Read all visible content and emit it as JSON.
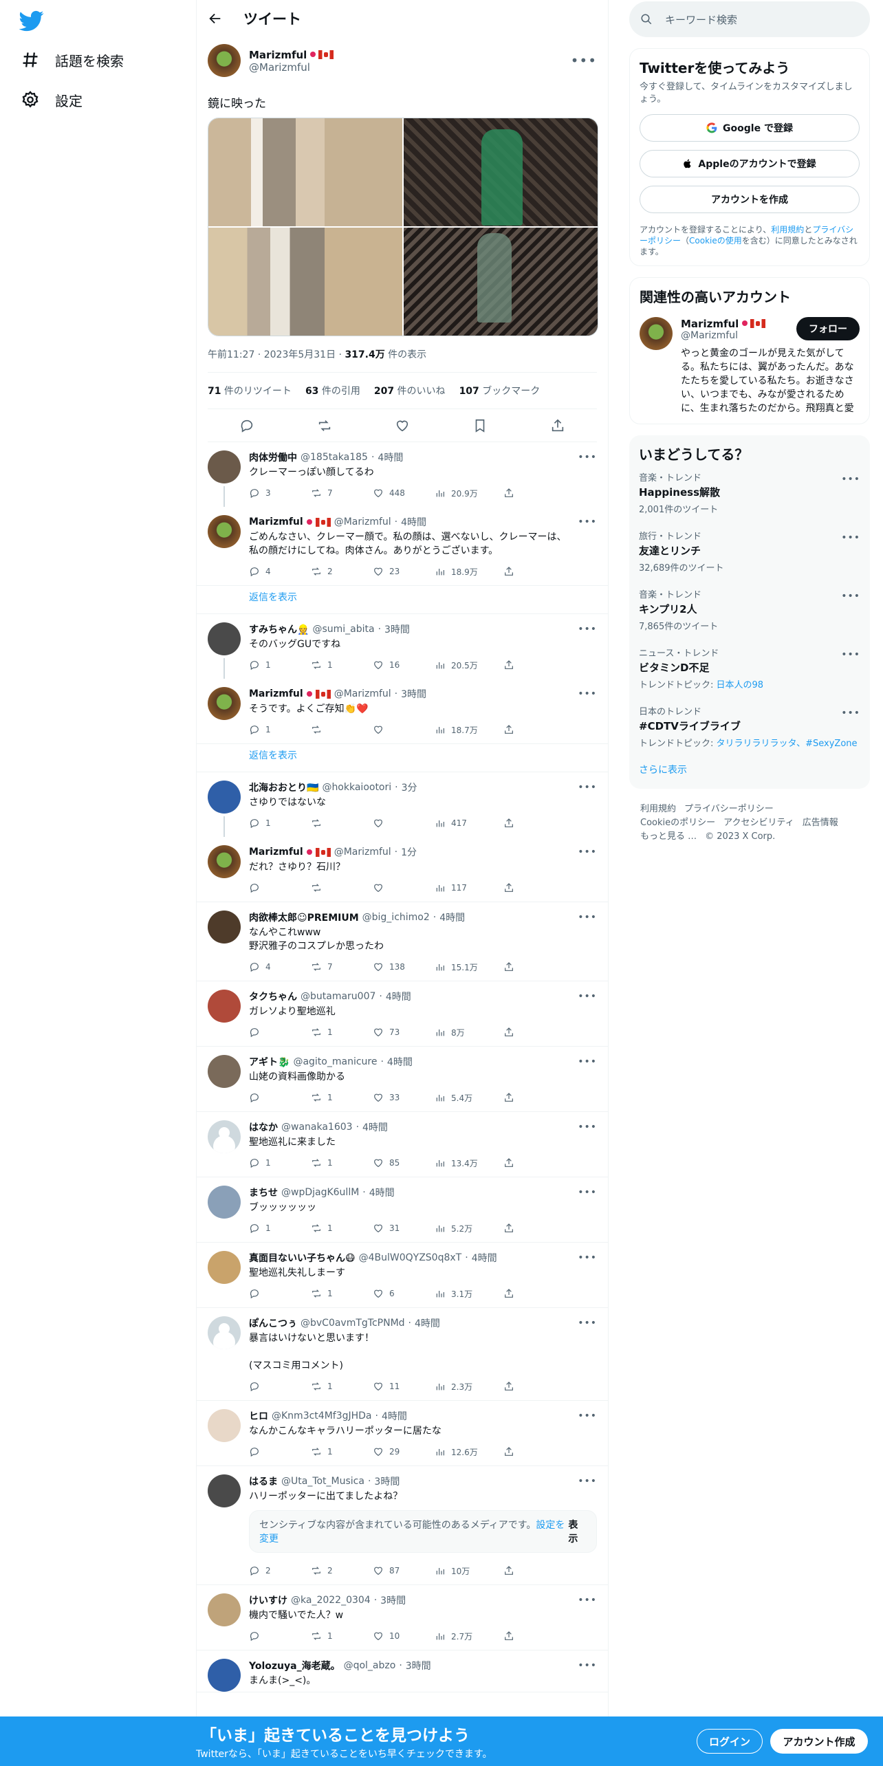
{
  "left": {
    "nav": [
      {
        "label": "話題を検索",
        "icon": "hash-icon"
      },
      {
        "label": "設定",
        "icon": "gear-icon"
      }
    ]
  },
  "header": {
    "title": "ツイート"
  },
  "tweet": {
    "name": "Marizmful",
    "handle": "@Marizmful",
    "text": "鏡に映った",
    "time": "午前11:27",
    "date": "2023年5月31日",
    "views_num": "317.4万",
    "views_label": " 件の表示",
    "stats": {
      "retweets": "71",
      "retweets_label": " 件のリツイート",
      "quotes": "63",
      "quotes_label": " 件の引用",
      "likes": "207",
      "likes_label": " 件のいいね",
      "bookmarks": "107",
      "bookmarks_label": " ブックマーク"
    }
  },
  "show_replies": "返信を表示",
  "replies": [
    {
      "name": "肉体労働中",
      "handle": "@185taka185",
      "time": "4時間",
      "text": "クレーマーっぽい顔してるわ",
      "reply": "3",
      "rt": "7",
      "like": "448",
      "views": "20.9万"
    },
    {
      "name": "Marizmful",
      "handle": "@Marizmful",
      "time": "4時間",
      "text": "ごめんなさい、クレーマー顔で。私の顔は、選べないし、クレーマーは、\n私の顔だけにしてね。肉体さん。ありがとうございます。",
      "reply": "4",
      "rt": "2",
      "like": "23",
      "views": "18.9万"
    },
    {
      "name": "すみちゃん👷",
      "handle": "@sumi_abita",
      "time": "3時間",
      "text": "そのバッグGUですね",
      "reply": "1",
      "rt": "1",
      "like": "16",
      "views": "20.5万"
    },
    {
      "name": "Marizmful",
      "handle": "@Marizmful",
      "time": "3時間",
      "text": "そうです。よくご存知👏❤️",
      "reply": "1",
      "rt": "",
      "like": "",
      "views": "18.7万"
    },
    {
      "name": "北海おおとり🇺🇦",
      "handle": "@hokkaiootori",
      "time": "3分",
      "text": "さゆりではないな",
      "reply": "1",
      "rt": "",
      "like": "",
      "views": "417"
    },
    {
      "name": "Marizmful",
      "handle": "@Marizmful",
      "time": "1分",
      "text": "だれ？さゆり？石川？",
      "reply": "",
      "rt": "",
      "like": "",
      "views": "117"
    },
    {
      "name": "肉欲棒太郎☺PREMIUM",
      "handle": "@big_ichimo2",
      "time": "4時間",
      "text": "なんやこれwww\n野沢雅子のコスプレか思ったわ",
      "reply": "4",
      "rt": "7",
      "like": "138",
      "views": "15.1万"
    },
    {
      "name": "タクちゃん",
      "handle": "@butamaru007",
      "time": "4時間",
      "text": "ガレソより聖地巡礼",
      "reply": "",
      "rt": "1",
      "like": "73",
      "views": "8万"
    },
    {
      "name": "アギト🐉",
      "handle": "@agito_manicure",
      "time": "4時間",
      "text": "山姥の資料画像助かる",
      "reply": "",
      "rt": "1",
      "like": "33",
      "views": "5.4万"
    },
    {
      "name": "はなか",
      "handle": "@wanaka1603",
      "time": "4時間",
      "text": "聖地巡礼に来ました",
      "reply": "1",
      "rt": "1",
      "like": "85",
      "views": "13.4万"
    },
    {
      "name": "まちせ",
      "handle": "@wpDjagK6ullM",
      "time": "4時間",
      "text": "ブッッッッッッ",
      "reply": "1",
      "rt": "1",
      "like": "31",
      "views": "5.2万"
    },
    {
      "name": "真面目ないい子ちゃん😷",
      "handle": "@4BulW0QYZS0q8xT",
      "time": "4時間",
      "text": "聖地巡礼失礼しまーす",
      "reply": "",
      "rt": "1",
      "like": "6",
      "views": "3.1万"
    },
    {
      "name": "ぽんこつぅ",
      "handle": "@bvC0avmTgTcPNMd",
      "time": "4時間",
      "text": "暴言はいけないと思います！\n\n(マスコミ用コメント)",
      "reply": "",
      "rt": "1",
      "like": "11",
      "views": "2.3万"
    },
    {
      "name": "ヒロ",
      "handle": "@Knm3ct4Mf3gJHDa",
      "time": "4時間",
      "text": "なんかこんなキャラハリーポッターに居たな",
      "reply": "",
      "rt": "1",
      "like": "29",
      "views": "12.6万"
    },
    {
      "name": "はるま",
      "handle": "@Uta_Tot_Musica",
      "time": "3時間",
      "text": "ハリーポッターに出てましたよね？",
      "reply": "2",
      "rt": "2",
      "like": "87",
      "views": "10万"
    },
    {
      "name": "けいすけ",
      "handle": "@ka_2022_0304",
      "time": "3時間",
      "text": "機内で騒いでた人？w",
      "reply": "",
      "rt": "1",
      "like": "10",
      "views": "2.7万"
    },
    {
      "name": "Yolozuya_海老蔵。",
      "handle": "@qol_abzo",
      "time": "3時間",
      "text": "まんま(>_<)。",
      "reply": "",
      "rt": "",
      "like": "",
      "views": ""
    }
  ],
  "sensitive": {
    "text": "センシティブな内容が含まれている可能性のあるメディアです。",
    "link": "設定を変更",
    "button": "表示"
  },
  "right": {
    "search_placeholder": "キーワード検索",
    "signup": {
      "title": "Twitterを使ってみよう",
      "sub": "今すぐ登録して、タイムラインをカスタマイズしましょう。",
      "google": "Google で登録",
      "apple": "Appleのアカウントで登録",
      "create": "アカウントを作成",
      "legal1": "アカウントを登録することにより、",
      "legal_link1": "利用規約",
      "legal2": "と",
      "legal_link2": "プライバシーポリシー",
      "legal3": "（",
      "legal_link3": "Cookieの使用",
      "legal4": "を含む）に同意したとみなされます。"
    },
    "relevant": {
      "title": "関連性の高いアカウント",
      "name": "Marizmful",
      "handle": "@Marizmful",
      "follow": "フォロー",
      "bio": "やっと黄金のゴールが見えた気がしてる。私たちには、翼があったんだ。あなたたちを愛している私たち。お逝きなさい、いつまでも、みなが愛されるために、生まれ落ちたのだから。飛翔真と愛"
    },
    "trends": {
      "title": "いまどうしてる？",
      "items": [
        {
          "cat": "音楽・トレンド",
          "title": "Happiness解散",
          "count": "2,001件のツイート"
        },
        {
          "cat": "旅行・トレンド",
          "title": "友達とリンチ",
          "count": "32,689件のツイート"
        },
        {
          "cat": "音楽・トレンド",
          "title": "キンプリ2人",
          "count": "7,865件のツイート"
        },
        {
          "cat": "ニュース・トレンド",
          "title": "ビタミンD不足",
          "count": "トレンドトピック: ",
          "count_link": "日本人の98"
        },
        {
          "cat": "日本のトレンド",
          "title": "#CDTVライブライブ",
          "count": "トレンドトピック: ",
          "count_link": "タリラリラリラッタ、#SexyZone"
        }
      ],
      "more": "さらに表示"
    },
    "footer": [
      "利用規約",
      "プライバシーポリシー",
      "Cookieのポリシー",
      "アクセシビリティ",
      "広告情報",
      "もっと見る …",
      "© 2023 X Corp."
    ]
  },
  "bottom": {
    "big": "「いま」起きていることを見つけよう",
    "small": "Twitterなら、「いま」起きていることをいち早くチェックできます。",
    "login": "ログイン",
    "signup": "アカウント作成"
  }
}
